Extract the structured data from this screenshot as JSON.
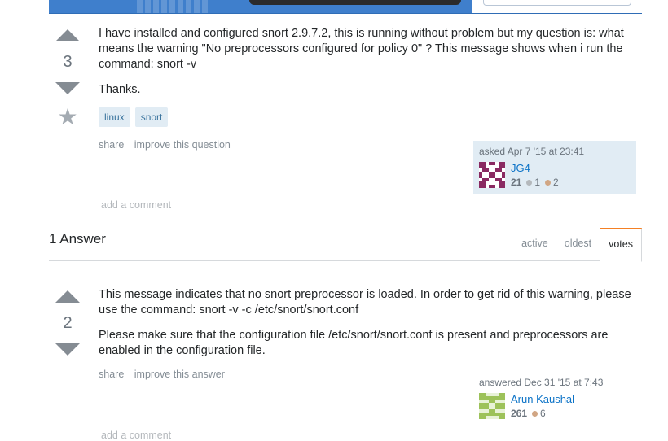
{
  "question": {
    "votes": "3",
    "body": [
      "I have installed and configured snort 2.9.7.2, this is running without problem but my question is: what means the warning \"No preprocessors configured for policy 0\" ? This message shows when i run the command: snort -v",
      "Thanks."
    ],
    "tags": [
      "linux",
      "snort"
    ],
    "menu": {
      "share": "share",
      "improve": "improve this question"
    },
    "signature": {
      "action": "asked Apr 7 '15 at 23:41",
      "user": "JG4",
      "reputation": "21",
      "silver": "1",
      "bronze": "2"
    },
    "add_comment": "add a comment"
  },
  "answers_header": {
    "count_label": "1 Answer",
    "tabs": [
      "active",
      "oldest",
      "votes"
    ],
    "active_tab": "votes"
  },
  "answer": {
    "votes": "2",
    "body": [
      "This message indicates that no snort preprocessor is loaded. In order to get rid of this warning, please use the command: snort -v -c /etc/snort/snort.conf",
      "Please make sure that the configuration file /etc/snort/snort.conf is present and preprocessors are enabled in the configuration file."
    ],
    "menu": {
      "share": "share",
      "improve": "improve this answer"
    },
    "signature": {
      "action": "answered Dec 31 '15 at 7:43",
      "user": "Arun Kaushal",
      "reputation": "261",
      "bronze": "6"
    },
    "add_comment": "add a comment"
  },
  "colors": {
    "accent": "#0c73c7",
    "tab_highlight": "#f48024",
    "owner_signature_bg": "#e1ecf4",
    "jg4_avatar": "#8a2a62",
    "arun_avatar": "#9dc25a"
  }
}
